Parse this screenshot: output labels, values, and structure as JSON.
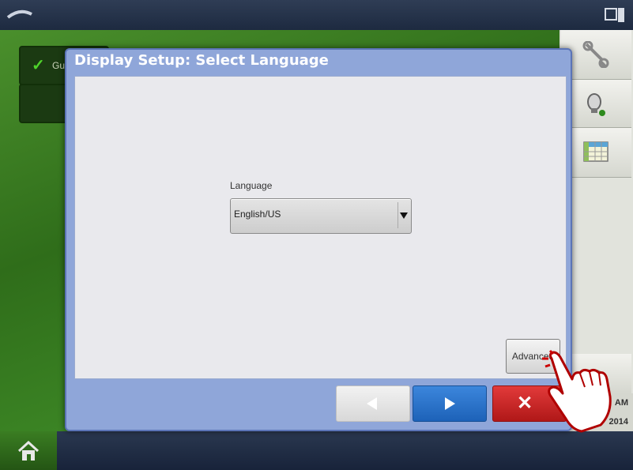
{
  "dialog": {
    "title": "Display Setup: Select Language",
    "language_label": "Language",
    "language_value": "English/US",
    "advanced_label": "Advanced"
  },
  "nav": {
    "prev_icon": "left-arrow-icon",
    "next_icon": "right-arrow-icon",
    "cancel_icon": "close-icon"
  },
  "background_tiles": [
    {
      "text": "Gu"
    }
  ],
  "clock": {
    "time_partial": "AM",
    "date_partial": "2014"
  },
  "colors": {
    "dialog_header": "#8fa6d9",
    "next_button": "#2a73cc",
    "cancel_button": "#cf2424",
    "green_bg": "#3b8424"
  }
}
